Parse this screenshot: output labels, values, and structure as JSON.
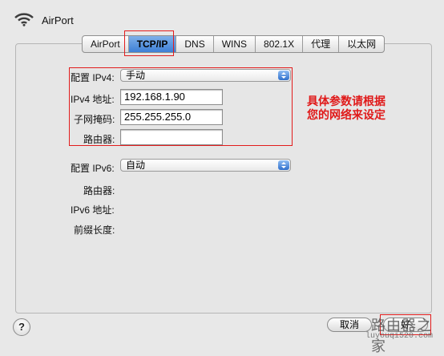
{
  "app": {
    "title": "AirPort"
  },
  "tabs": [
    {
      "label": "AirPort"
    },
    {
      "label": "TCP/IP",
      "active": true
    },
    {
      "label": "DNS"
    },
    {
      "label": "WINS"
    },
    {
      "label": "802.1X"
    },
    {
      "label": "代理"
    },
    {
      "label": "以太网"
    }
  ],
  "ipv4": {
    "config_label": "配置 IPv4:",
    "config_value": "手动",
    "address_label": "IPv4 地址:",
    "address_value": "192.168.1.90",
    "subnet_label": "子网掩码:",
    "subnet_value": "255.255.255.0",
    "router_label": "路由器:",
    "router_value": ""
  },
  "ipv6": {
    "config_label": "配置 IPv6:",
    "config_value": "自动",
    "router_label": "路由器:",
    "address_label": "IPv6 地址:",
    "prefix_label": "前缀长度:"
  },
  "annotation": {
    "line1": "具体参数请根据",
    "line2": "您的网络来设定"
  },
  "footer": {
    "help_label": "?",
    "cancel_label": "取消",
    "ok_label": "好"
  },
  "watermark": {
    "text": "路由器之家",
    "url": "luyouqi520.com"
  },
  "colors": {
    "highlight": "#e21c1c",
    "annotation": "#e01919",
    "active_tab": "#3d7fd6"
  }
}
